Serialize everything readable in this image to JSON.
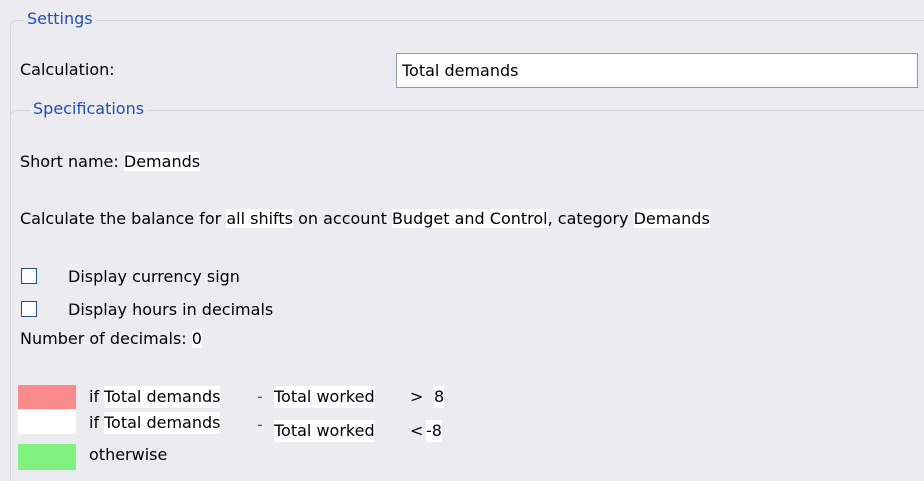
{
  "settings": {
    "legend": "Settings",
    "calculation_label": "Calculation:",
    "calculation_value": "Total demands"
  },
  "specifications": {
    "legend": "Specifications",
    "short_name_label": "Short name:",
    "short_name_value": "Demands",
    "balance_prefix": "Calculate the balance for",
    "balance_shifts": "all shifts",
    "balance_mid": "on account",
    "balance_account": "Budget and Control",
    "balance_cat_label": ", category",
    "balance_category": "Demands",
    "display_currency_label": "Display currency sign",
    "display_currency_checked": false,
    "display_hours_label": "Display hours in decimals",
    "display_hours_checked": false,
    "decimals_label": "Number of decimals:",
    "decimals_value": "0"
  },
  "rules": [
    {
      "color": "#f98b8b",
      "if": "if",
      "left": "Total demands",
      "op_sep": "-",
      "right": "Total worked",
      "cmp": ">",
      "value": "8"
    },
    {
      "color": "#ffffff",
      "if": "if",
      "left": "Total demands",
      "op_sep": "-",
      "right": "Total worked",
      "cmp": "<",
      "value": "-8"
    },
    {
      "color": "#80f080",
      "otherwise": "otherwise"
    }
  ]
}
